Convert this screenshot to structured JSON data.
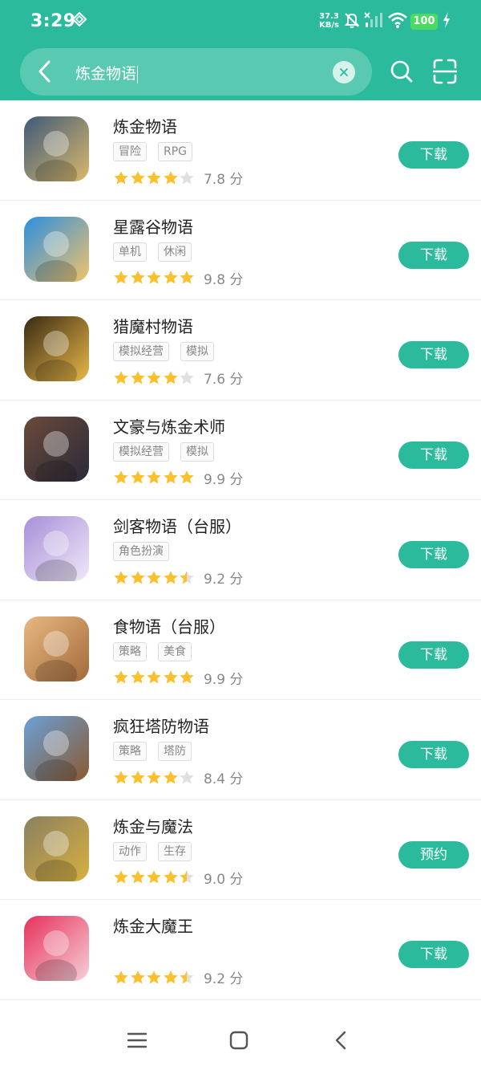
{
  "status": {
    "time": "3:29",
    "net_speed_value": "37.3",
    "net_speed_unit": "KB/s",
    "battery": "100"
  },
  "search": {
    "query": "炼金物语"
  },
  "apps": [
    {
      "name": "炼金物语",
      "tags": [
        "冒险",
        "RPG"
      ],
      "stars": [
        1,
        1,
        1,
        1,
        0
      ],
      "score": "7.8 分",
      "action": "下载",
      "icon_colors": [
        "#3f5a7a",
        "#d9b86b"
      ]
    },
    {
      "name": "星露谷物语",
      "tags": [
        "单机",
        "休闲"
      ],
      "stars": [
        1,
        1,
        1,
        1,
        1
      ],
      "score": "9.8 分",
      "action": "下载",
      "icon_colors": [
        "#2c8fe0",
        "#f0c36a"
      ]
    },
    {
      "name": "猎魔村物语",
      "tags": [
        "模拟经营",
        "模拟"
      ],
      "stars": [
        1,
        1,
        1,
        1,
        0
      ],
      "score": "7.6 分",
      "action": "下载",
      "icon_colors": [
        "#3a2a14",
        "#e8b848"
      ]
    },
    {
      "name": "文豪与炼金术师",
      "tags": [
        "模拟经营",
        "模拟"
      ],
      "stars": [
        1,
        1,
        1,
        1,
        1
      ],
      "score": "9.9 分",
      "action": "下载",
      "icon_colors": [
        "#6b4a3a",
        "#2a2a3a"
      ]
    },
    {
      "name": "剑客物语（台服）",
      "tags": [
        "角色扮演"
      ],
      "stars": [
        1,
        1,
        1,
        1,
        0.5
      ],
      "score": "9.2 分",
      "action": "下载",
      "icon_colors": [
        "#a78fd8",
        "#f0e8f8"
      ]
    },
    {
      "name": "食物语（台服）",
      "tags": [
        "策略",
        "美食"
      ],
      "stars": [
        1,
        1,
        1,
        1,
        1
      ],
      "score": "9.9 分",
      "action": "下载",
      "icon_colors": [
        "#e8b880",
        "#a36a3a"
      ]
    },
    {
      "name": "疯狂塔防物语",
      "tags": [
        "策略",
        "塔防"
      ],
      "stars": [
        1,
        1,
        1,
        1,
        0
      ],
      "score": "8.4 分",
      "action": "下载",
      "icon_colors": [
        "#6aa0d8",
        "#8a5a30"
      ]
    },
    {
      "name": "炼金与魔法",
      "tags": [
        "动作",
        "生存"
      ],
      "stars": [
        1,
        1,
        1,
        1,
        0.5
      ],
      "score": "9.0 分",
      "action": "预约",
      "icon_colors": [
        "#8a8060",
        "#d8b040"
      ]
    },
    {
      "name": "炼金大魔王",
      "tags": [],
      "stars": [
        1,
        1,
        1,
        1,
        0.5
      ],
      "score": "9.2 分",
      "action": "下载",
      "icon_colors": [
        "#e8305a",
        "#f4d0d8"
      ]
    }
  ],
  "colors": {
    "accent": "#2bbb9c",
    "star": "#fbc02d",
    "star_empty": "#e0e0e0",
    "text_muted": "#888888"
  },
  "icons": {
    "back": "chevron-left-icon",
    "clear": "close-icon",
    "search": "search-icon",
    "scan": "scan-icon",
    "nav_menu": "menu-icon",
    "nav_home": "home-icon",
    "nav_back": "back-icon"
  }
}
